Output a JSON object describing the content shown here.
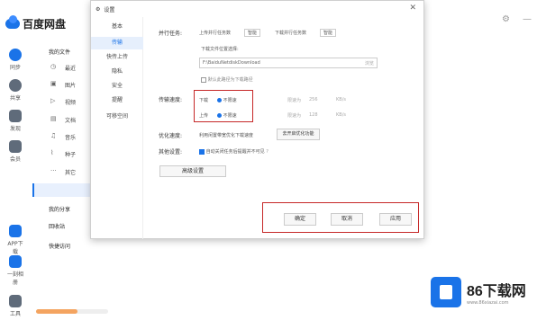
{
  "app": {
    "title": "百度网盘"
  },
  "rail": [
    {
      "label": "同步",
      "color": "#1a73e8"
    },
    {
      "label": "共享",
      "color": "#5f6b7a"
    },
    {
      "label": "发现",
      "color": "#5f6b7a"
    },
    {
      "label": "会员",
      "color": "#5f6b7a"
    },
    {
      "label": "APP下载",
      "color": "#1a73e8"
    },
    {
      "label": "一刻相册",
      "color": "#1a73e8"
    },
    {
      "label": "工具",
      "color": "#5f6b7a"
    }
  ],
  "sidebar": {
    "my_files": "我的文件",
    "items": [
      "最近",
      "图片",
      "视频",
      "文档",
      "音乐",
      "种子",
      "其它"
    ],
    "item_icons": [
      "◷",
      "▣",
      "▷",
      "▤",
      "♫",
      "⌇",
      "···"
    ],
    "my_share": "我的分享",
    "recycle": "回收站",
    "quick_access": "快捷访问"
  },
  "dialog": {
    "title": "设置",
    "close": "✕",
    "nav": [
      "基本",
      "传输",
      "快传上传",
      "隐私",
      "安全",
      "提醒",
      "可移空间"
    ],
    "parallel": {
      "label": "并行任务:",
      "upload": "上传并行任务数",
      "upload_val": "智能",
      "download": "下载并行任务数",
      "download_val": "智能"
    },
    "download_path": {
      "label": "下载文件位置选择:",
      "value": "F:\\BaiduNetdiskDownload",
      "browse": "浏览"
    },
    "default_path": "默认此路径为下载路径",
    "speed": {
      "label": "传输速度:",
      "download": "下载",
      "upload": "上传",
      "unlimited": "不限速",
      "limit": "限速为",
      "dl_limit": "256",
      "ul_limit": "128",
      "unit": "KB/s"
    },
    "optimize": {
      "label": "优化速度:",
      "text": "利用闲置带宽优化下载速度",
      "button": "去开启优化功能"
    },
    "other": {
      "label": "其他设置:",
      "text": "自动关闭任务后提醒并不可见"
    },
    "advanced_button": "高级设置",
    "ok": "确定",
    "cancel": "取消",
    "apply": "应用"
  },
  "watermark": {
    "title": "86下载网",
    "sub": "www.86xiazai.com"
  }
}
